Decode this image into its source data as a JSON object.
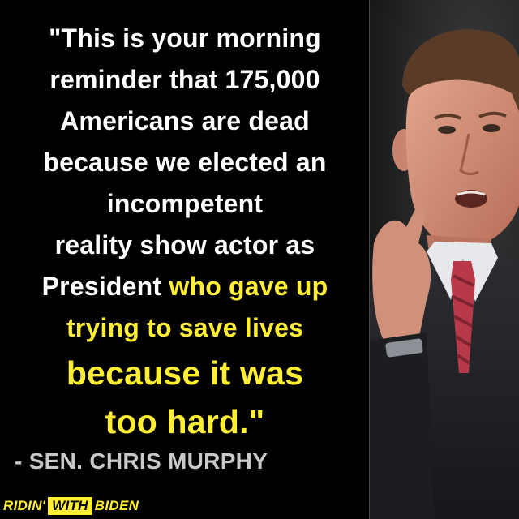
{
  "quote": {
    "lines": [
      "\"This is your morning",
      "reminder that 175,000",
      "Americans are dead",
      "because we elected an",
      "incompetent",
      "reality show actor as"
    ],
    "mixed_line": {
      "plain": "President ",
      "highlight": "who gave up"
    },
    "highlight_lines": [
      "trying to save lives"
    ],
    "big_lines": [
      "because it was",
      "too hard.\""
    ]
  },
  "attribution": "- SEN. CHRIS MURPHY",
  "logo": {
    "part1": "RIDIN'",
    "part2": "WITH",
    "part3": "BIDEN"
  },
  "colors": {
    "background": "#000000",
    "text": "#ffffff",
    "highlight": "#ffee33",
    "attribution": "#c9c9c9"
  }
}
